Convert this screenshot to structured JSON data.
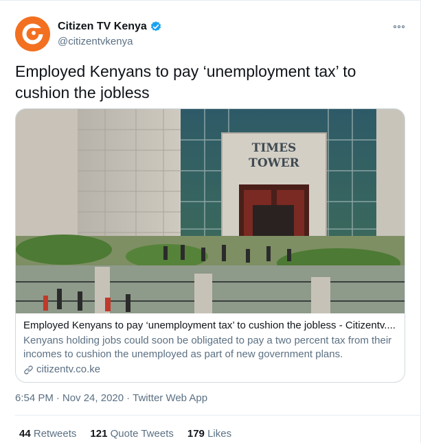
{
  "account": {
    "display_name": "Citizen TV Kenya",
    "handle": "@citizentvkenya",
    "avatar_icon": "citizen-tv-logo",
    "verified_icon": "verified-badge-icon",
    "brand_color": "#f37021",
    "verified_color": "#1da1f2"
  },
  "tweet": {
    "text": "Employed Kenyans to pay ‘unemployment tax’ to cushion the jobless"
  },
  "card": {
    "image_sign_line1": "TIMES",
    "image_sign_line2": "TOWER",
    "title": "Employed Kenyans to pay ‘unemployment tax’ to cushion the jobless - Citizentv....",
    "description": "Kenyans holding jobs could soon be obligated to pay a two percent tax from their incomes to cushion the unemployed as part of new government plans.",
    "domain": "citizentv.co.ke",
    "link_icon": "link-icon"
  },
  "meta": {
    "time": "6:54 PM",
    "separator1": "·",
    "date": "Nov 24, 2020",
    "separator2": "·",
    "source": "Twitter Web App"
  },
  "stats": {
    "retweets_count": "44",
    "retweets_label": "Retweets",
    "quotes_count": "121",
    "quotes_label": "Quote Tweets",
    "likes_count": "179",
    "likes_label": "Likes"
  }
}
